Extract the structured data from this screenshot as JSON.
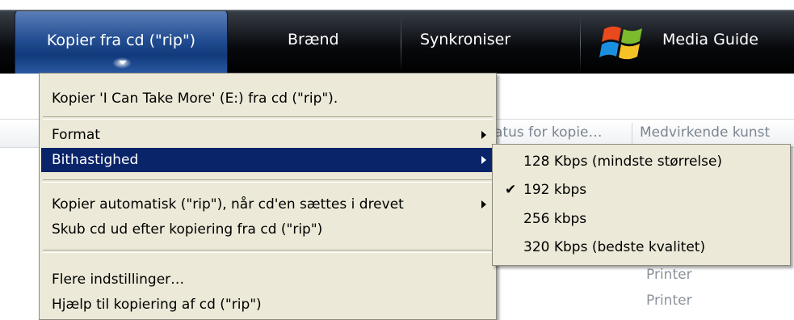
{
  "tabs": [
    {
      "label": "Kopier fra cd (\"rip\")",
      "active": true
    },
    {
      "label": "Brænd",
      "active": false
    },
    {
      "label": "Synkroniser",
      "active": false
    },
    {
      "label": "Media Guide",
      "active": false
    }
  ],
  "logo_icon": "windows-flag-icon",
  "columns": {
    "status": "atus for kopie…",
    "contributing_artist": "Medvirkende kunst"
  },
  "background_cells": [
    "Printer",
    "Printer"
  ],
  "rip_menu": {
    "rip_disc": "Kopier 'I Can Take More' (E:) fra cd (\"rip\").",
    "format": "Format",
    "bitrate": "Bithastighed",
    "auto_rip": "Kopier automatisk (\"rip\"), når cd'en sættes i drevet",
    "eject": "Skub cd ud efter kopiering fra cd (\"rip\")",
    "more_options": "Flere indstillinger…",
    "help": "Hjælp til kopiering af cd (\"rip\")"
  },
  "bitrate_menu": {
    "options": [
      {
        "label": "128 Kbps (mindste størrelse)",
        "checked": false
      },
      {
        "label": "192 kbps",
        "checked": true
      },
      {
        "label": "256 kbps",
        "checked": false
      },
      {
        "label": "320 Kbps (bedste kvalitet)",
        "checked": false
      }
    ],
    "check_glyph": "✔"
  },
  "colors": {
    "menu_background": "#ece9d8",
    "menu_highlight": "#0a246a",
    "active_tab": "#244e93"
  }
}
